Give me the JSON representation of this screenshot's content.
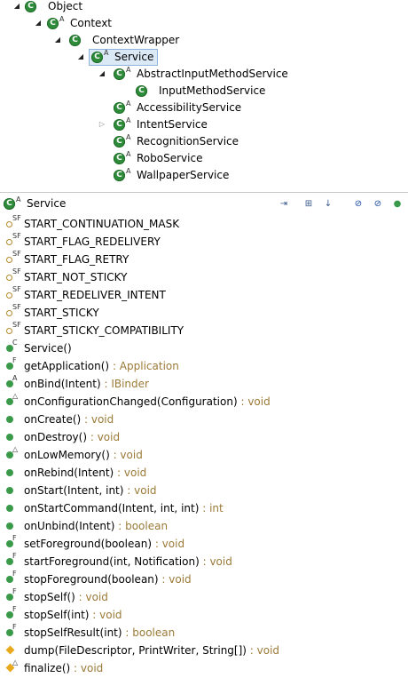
{
  "hierarchy": {
    "nodes": [
      {
        "label": "Object",
        "sup": ""
      },
      {
        "label": "Context",
        "sup": "A"
      },
      {
        "label": "ContextWrapper",
        "sup": ""
      },
      {
        "label": "Service",
        "sup": "A"
      },
      {
        "label": "AbstractInputMethodService",
        "sup": "A"
      },
      {
        "label": "InputMethodService",
        "sup": ""
      },
      {
        "label": "AccessibilityService",
        "sup": "A"
      },
      {
        "label": "IntentService",
        "sup": "A"
      },
      {
        "label": "RecognitionService",
        "sup": "A"
      },
      {
        "label": "RoboService",
        "sup": "A"
      },
      {
        "label": "WallpaperService",
        "sup": "A"
      }
    ]
  },
  "members_view": {
    "title": "Service",
    "title_sup": "A",
    "toolbar": {
      "icons": [
        "focus-icon",
        "hierarchy-mode-icon",
        "sort-icon",
        "hide-fields-icon",
        "hide-static-icon",
        "hide-nonpublic-icon"
      ]
    }
  },
  "members": [
    {
      "mod": "SF",
      "name": "START_CONTINUATION_MASK",
      "ret": "",
      "icon": "ring"
    },
    {
      "mod": "SF",
      "name": "START_FLAG_REDELIVERY",
      "ret": "",
      "icon": "ring"
    },
    {
      "mod": "SF",
      "name": "START_FLAG_RETRY",
      "ret": "",
      "icon": "ring"
    },
    {
      "mod": "SF",
      "name": "START_NOT_STICKY",
      "ret": "",
      "icon": "ring"
    },
    {
      "mod": "SF",
      "name": "START_REDELIVER_INTENT",
      "ret": "",
      "icon": "ring"
    },
    {
      "mod": "SF",
      "name": "START_STICKY",
      "ret": "",
      "icon": "ring"
    },
    {
      "mod": "SF",
      "name": "START_STICKY_COMPATIBILITY",
      "ret": "",
      "icon": "ring"
    },
    {
      "mod": "C",
      "name": "Service()",
      "ret": "",
      "icon": "public"
    },
    {
      "mod": "F",
      "name": "getApplication()",
      "ret": " : Application",
      "icon": "public"
    },
    {
      "mod": "A",
      "name": "onBind(Intent)",
      "ret": " : IBinder",
      "icon": "public"
    },
    {
      "mod": "△",
      "name": "onConfigurationChanged(Configuration)",
      "ret": " : void",
      "icon": "public"
    },
    {
      "mod": "",
      "name": "onCreate()",
      "ret": " : void",
      "icon": "public"
    },
    {
      "mod": "",
      "name": "onDestroy()",
      "ret": " : void",
      "icon": "public"
    },
    {
      "mod": "△",
      "name": "onLowMemory()",
      "ret": " : void",
      "icon": "public"
    },
    {
      "mod": "",
      "name": "onRebind(Intent)",
      "ret": " : void",
      "icon": "public"
    },
    {
      "mod": "",
      "name": "onStart(Intent, int)",
      "ret": " : void",
      "icon": "public"
    },
    {
      "mod": "",
      "name": "onStartCommand(Intent, int, int)",
      "ret": " : int",
      "icon": "public"
    },
    {
      "mod": "",
      "name": "onUnbind(Intent)",
      "ret": " : boolean",
      "icon": "public"
    },
    {
      "mod": "F",
      "name": "setForeground(boolean)",
      "ret": " : void",
      "icon": "public"
    },
    {
      "mod": "F",
      "name": "startForeground(int, Notification)",
      "ret": " : void",
      "icon": "public"
    },
    {
      "mod": "F",
      "name": "stopForeground(boolean)",
      "ret": " : void",
      "icon": "public"
    },
    {
      "mod": "F",
      "name": "stopSelf()",
      "ret": " : void",
      "icon": "public"
    },
    {
      "mod": "F",
      "name": "stopSelf(int)",
      "ret": " : void",
      "icon": "public"
    },
    {
      "mod": "F",
      "name": "stopSelfResult(int)",
      "ret": " : boolean",
      "icon": "public"
    },
    {
      "mod": "",
      "name": "dump(FileDescriptor, PrintWriter, String[])",
      "ret": " : void",
      "icon": "protected"
    },
    {
      "mod": "△",
      "name": "finalize()",
      "ret": " : void",
      "icon": "protected"
    }
  ]
}
